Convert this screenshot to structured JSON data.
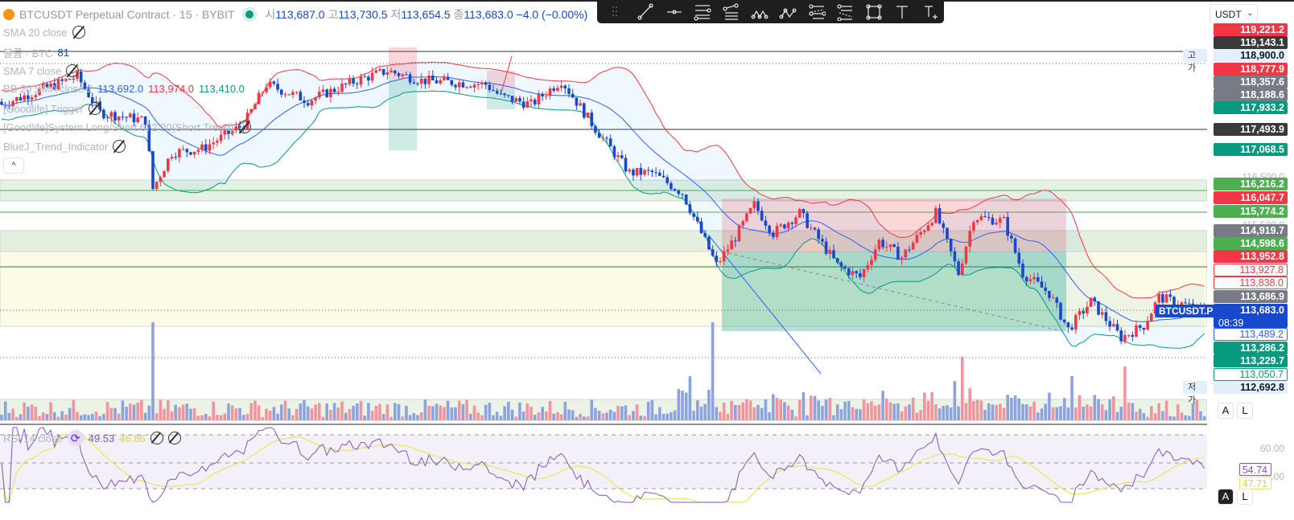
{
  "header": {
    "symbol_title": "BTCUSDT Perpetual Contract · 15 · BYBIT",
    "ohlc": [
      {
        "key": "시",
        "value": "113,687.0"
      },
      {
        "key": "고",
        "value": "113,730.5"
      },
      {
        "key": "저",
        "value": "113,654.5"
      },
      {
        "key": "종",
        "value": "113,683.0"
      }
    ],
    "change": "−4.0 (−0.00%)"
  },
  "indicators": [
    {
      "label": "SMA 20 close",
      "hidden": true
    },
    {
      "label": "볼륨 · BTC",
      "value": "81"
    },
    {
      "label": "SMA 7 close",
      "hidden": true
    },
    {
      "label": "BB 20 SMA close 2",
      "values": [
        "113,692.0",
        "113,974.0",
        "113,410.0"
      ]
    },
    {
      "label": "[Goodlife] Trigger",
      "hidden": true
    },
    {
      "label": "[Goodlife]System Long/Short 672 20(Short Trend)",
      "hidden": true
    },
    {
      "label": "BlueJ_Trend_Indicator",
      "hidden": true
    }
  ],
  "collapse_label": "^",
  "toolbar": [
    "drag-handle",
    "trend-line",
    "horizontal-ray",
    "parallel-channel",
    "fib-retracement",
    "xabcd-pattern",
    "abcd-pattern",
    "fib-channel",
    "regression-trend",
    "rectangle",
    "text",
    "text-anchored"
  ],
  "currency": "USDT",
  "currency_chevron": "⌄",
  "price_labels": [
    {
      "price": "119,221.2",
      "bg": "#f23645",
      "fg": "#ffffff"
    },
    {
      "price": "119,143.1",
      "bg": "#3a3a3a",
      "fg": "#ffffff"
    },
    {
      "price": "118,900.0",
      "bg": "#e3effc",
      "fg": "#131722",
      "tag": "고가"
    },
    {
      "price": "118,777.9",
      "bg": "#f23645",
      "fg": "#ffffff"
    },
    {
      "price": "118,357.6",
      "bg": "#787b86",
      "fg": "#ffffff"
    },
    {
      "price": "118,188.6",
      "bg": "#787b86",
      "fg": "#ffffff"
    },
    {
      "price": "117,933.2",
      "bg": "#089981",
      "fg": "#ffffff"
    },
    {
      "price": "117,493.9",
      "bg": "#3a3a3a",
      "fg": "#ffffff"
    },
    {
      "price": "117,068.5",
      "bg": "#089981",
      "fg": "#ffffff"
    },
    {
      "price": "116,216.2",
      "bg": "#4caf50",
      "fg": "#ffffff"
    },
    {
      "price": "116,047.7",
      "bg": "#f23645",
      "fg": "#ffffff"
    },
    {
      "price": "115,774.2",
      "bg": "#4caf50",
      "fg": "#ffffff"
    },
    {
      "price": "114,919.7",
      "bg": "#787b86",
      "fg": "#ffffff"
    },
    {
      "price": "114,598.6",
      "bg": "#4caf50",
      "fg": "#ffffff"
    },
    {
      "price": "113,952.8",
      "bg": "#f23645",
      "fg": "#ffffff"
    },
    {
      "price": "113,927.8",
      "bg": "#ffffff",
      "fg": "#f23645",
      "border": "#f23645"
    },
    {
      "price": "113,838.0",
      "bg": "#ffffff",
      "fg": "#f23645",
      "border": "#f23645"
    },
    {
      "price": "113,686.9",
      "bg": "#787b86",
      "fg": "#ffffff"
    },
    {
      "price": "113,683.0",
      "bg": "#1848cc",
      "fg": "#ffffff",
      "sub": "08:39"
    },
    {
      "price": "113,489.2",
      "bg": "#ffffff",
      "fg": "#2962ff",
      "border": "#2962ff"
    },
    {
      "price": "113,286.2",
      "bg": "#089981",
      "fg": "#ffffff"
    },
    {
      "price": "113,229.7",
      "bg": "#089981",
      "fg": "#ffffff"
    },
    {
      "price": "113,050.7",
      "bg": "#ffffff",
      "fg": "#089981",
      "border": "#089981"
    },
    {
      "price": "112,692.8",
      "bg": "#e3effc",
      "fg": "#131722",
      "tag": "저가"
    }
  ],
  "axis_ticks": [
    "116,500.0",
    "115,500.0"
  ],
  "symbol_badge": "BTCUSDT.P",
  "scale_buttons": {
    "auto": "A",
    "log": "L"
  },
  "rsi": {
    "label": "RSI 14 close",
    "value": "49.53",
    "ma_value": "46.86",
    "axis_ticks": [
      "60.00",
      "40.00"
    ],
    "last_rsi": "54.74",
    "last_ma": "47.71",
    "refresh_icon": "⟳"
  },
  "colors": {
    "up": "#f23645",
    "down": "#1848cc",
    "bb_upper": "#f23645",
    "bb_basis": "#2962ff",
    "bb_lower": "#089981",
    "rsi": "#7e57c2",
    "rsi_ma": "#e5e85a"
  },
  "price_path": [
    [
      0,
      117983
    ],
    [
      20,
      118567
    ],
    [
      26,
      117817
    ],
    [
      38,
      117650
    ],
    [
      40,
      116233
    ],
    [
      45,
      116983
    ],
    [
      53,
      117067
    ],
    [
      64,
      117567
    ],
    [
      70,
      118400
    ],
    [
      81,
      118067
    ],
    [
      94,
      118483
    ],
    [
      102,
      118683
    ],
    [
      111,
      118483
    ],
    [
      128,
      118400
    ],
    [
      132,
      118150
    ],
    [
      140,
      117983
    ],
    [
      148,
      118483
    ],
    [
      157,
      117483
    ],
    [
      166,
      116567
    ],
    [
      172,
      116567
    ],
    [
      180,
      116150
    ],
    [
      185,
      115317
    ],
    [
      189,
      114650
    ],
    [
      194,
      115233
    ],
    [
      199,
      115900
    ],
    [
      204,
      115317
    ],
    [
      211,
      115733
    ],
    [
      221,
      114650
    ],
    [
      227,
      114400
    ],
    [
      232,
      115150
    ],
    [
      238,
      114817
    ],
    [
      247,
      115733
    ],
    [
      253,
      114483
    ],
    [
      257,
      115650
    ],
    [
      265,
      115567
    ],
    [
      270,
      114483
    ],
    [
      277,
      114067
    ],
    [
      282,
      113317
    ],
    [
      288,
      113900
    ],
    [
      296,
      113150
    ],
    [
      302,
      113400
    ],
    [
      306,
      113983
    ],
    [
      312,
      113850
    ],
    [
      318,
      113683
    ]
  ],
  "volume_spikes": [
    [
      40,
      1.0
    ],
    [
      188,
      1.0
    ],
    [
      182,
      0.45
    ],
    [
      254,
      0.65
    ],
    [
      297,
      0.55
    ],
    [
      252,
      0.4
    ],
    [
      283,
      0.45
    ]
  ]
}
